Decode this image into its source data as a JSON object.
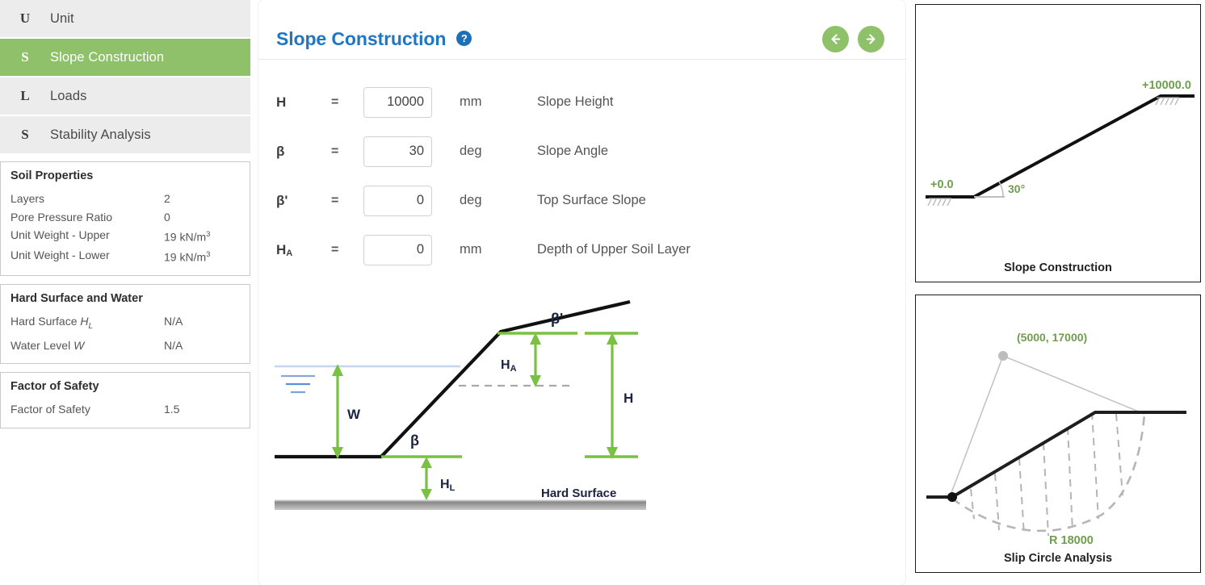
{
  "sidebar": {
    "items": [
      {
        "icon": "U",
        "icon_name": "unit-letter-icon",
        "label": "Unit",
        "active": false
      },
      {
        "icon": "S",
        "icon_name": "slope-letter-icon",
        "label": "Slope Construction",
        "active": true
      },
      {
        "icon": "L",
        "icon_name": "loads-letter-icon",
        "label": "Loads",
        "active": false
      },
      {
        "icon": "S",
        "icon_name": "stability-letter-icon",
        "label": "Stability Analysis",
        "active": false
      }
    ],
    "panels": [
      {
        "title": "Soil Properties",
        "rows": [
          {
            "key": "Layers",
            "value": "2"
          },
          {
            "key": "Pore Pressure Ratio",
            "value": "0"
          },
          {
            "key": "Unit Weight - Upper",
            "value": "19 kN/m",
            "sup": "3"
          },
          {
            "key": "Unit Weight - Lower",
            "value": "19 kN/m",
            "sup": "3"
          }
        ]
      },
      {
        "title": "Hard Surface and Water",
        "rows": [
          {
            "key": "Hard Surface ",
            "key_italic": "H",
            "key_sub": "L",
            "value": "N/A"
          },
          {
            "key": "Water Level ",
            "key_italic": "W",
            "value": "N/A"
          }
        ]
      },
      {
        "title": "Factor of Safety",
        "rows": [
          {
            "key": "Factor of Safety",
            "value": "1.5"
          }
        ]
      }
    ]
  },
  "header": {
    "title": "Slope Construction",
    "help_icon": "help-circle-icon",
    "help_glyph": "?",
    "prev_label": "previous-step",
    "next_label": "next-step"
  },
  "form": {
    "fields": [
      {
        "symbol": "H",
        "sub": "",
        "eq": "=",
        "value": "10000",
        "unit": "mm",
        "description": "Slope Height"
      },
      {
        "symbol": "β",
        "sub": "",
        "eq": "=",
        "value": "30",
        "unit": "deg",
        "description": "Slope Angle"
      },
      {
        "symbol": "β'",
        "sub": "",
        "eq": "=",
        "value": "0",
        "unit": "deg",
        "description": "Top Surface Slope"
      },
      {
        "symbol": "H",
        "sub": "A",
        "eq": "=",
        "value": "0",
        "unit": "mm",
        "description": "Depth of Upper Soil Layer"
      }
    ]
  },
  "main_diagram": {
    "labels": {
      "water": "W",
      "slope_angle": "β",
      "top_surface_slope": "β'",
      "upper_layer_depth": "H",
      "upper_layer_depth_sub": "A",
      "slope_height": "H",
      "hard_surface_depth": "H",
      "hard_surface_depth_sub": "L",
      "hard_surface": "Hard Surface"
    },
    "colors": {
      "dimension": "#7ac143",
      "ground": "#111111",
      "water": "#5b8fd4",
      "label": "#1c2340"
    }
  },
  "right_panels": [
    {
      "caption": "Slope Construction",
      "type": "slope-construction-preview",
      "annotations": {
        "base_level": "+0.0",
        "top_level": "+10000.0",
        "angle": "30°"
      },
      "colors": {
        "annotation": "#6f9e4e",
        "line": "#111111"
      }
    },
    {
      "caption": "Slip Circle Analysis",
      "type": "slip-circle-preview",
      "annotations": {
        "centre": "(5000, 17000)",
        "radius": "R 18000"
      },
      "colors": {
        "annotation": "#6f9e4e",
        "line": "#111111",
        "slip": "#b5b5b5"
      }
    }
  ],
  "theme": {
    "accent_green": "#8fc06a",
    "title_blue": "#1f77c4",
    "dimension_green": "#7ac143",
    "sidebar_item_bg": "#ececec"
  }
}
